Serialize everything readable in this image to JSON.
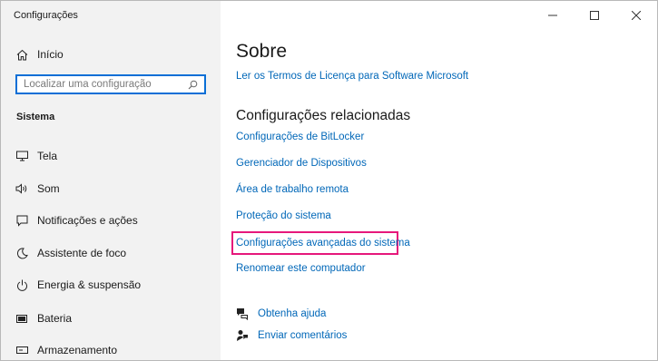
{
  "window": {
    "title": "Configurações",
    "minimize_icon": "minimize-icon",
    "maximize_icon": "maximize-icon",
    "close_icon": "close-icon"
  },
  "sidebar": {
    "home_label": "Início",
    "search": {
      "placeholder": "Localizar uma configuração",
      "value": ""
    },
    "section_title": "Sistema",
    "items": [
      {
        "label": "Tela",
        "icon": "monitor-icon"
      },
      {
        "label": "Som",
        "icon": "speaker-icon"
      },
      {
        "label": "Notificações e ações",
        "icon": "notification-icon"
      },
      {
        "label": "Assistente de foco",
        "icon": "moon-icon"
      },
      {
        "label": "Energia & suspensão",
        "icon": "power-icon"
      },
      {
        "label": "Bateria",
        "icon": "battery-icon"
      },
      {
        "label": "Armazenamento",
        "icon": "storage-icon"
      }
    ]
  },
  "main": {
    "title": "Sobre",
    "license_link": "Ler os Termos de Licença para Software Microsoft",
    "related_title": "Configurações relacionadas",
    "related_links": [
      "Configurações de BitLocker",
      "Gerenciador de Dispositivos",
      "Área de trabalho remota",
      "Proteção do sistema",
      "Configurações avançadas do sistema",
      "Renomear este computador"
    ],
    "help": [
      {
        "label": "Obtenha ajuda",
        "icon": "help-chat-icon"
      },
      {
        "label": "Enviar comentários",
        "icon": "feedback-icon"
      }
    ]
  },
  "colors": {
    "link": "#0067b8",
    "highlight": "#e6187b",
    "search_border": "#0a6fd6",
    "sidebar_bg": "#f2f2f2"
  }
}
